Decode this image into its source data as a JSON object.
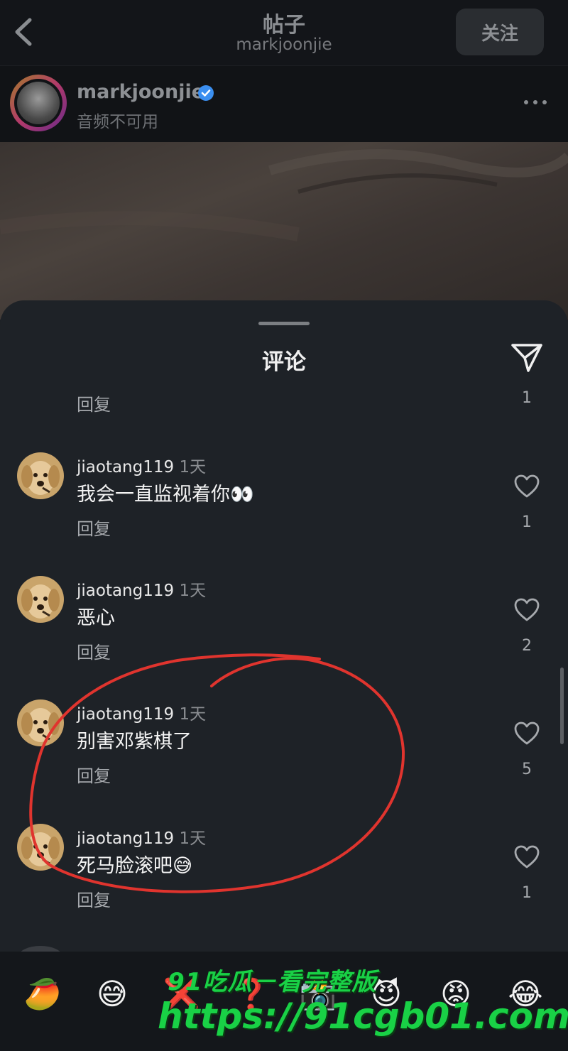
{
  "header": {
    "title": "帖子",
    "subtitle": "markjoonjie",
    "follow_label": "关注"
  },
  "author": {
    "name": "markjoonjie",
    "status": "音频不可用"
  },
  "sheet": {
    "title": "评论",
    "top_reply": "回复",
    "top_count": "1"
  },
  "comments": [
    {
      "user": "jiaotang119",
      "time": "1天",
      "text": "我会一直监视着你👀",
      "reply": "回复",
      "likes": "1"
    },
    {
      "user": "jiaotang119",
      "time": "1天",
      "text": "恶心",
      "reply": "回复",
      "likes": "2"
    },
    {
      "user": "jiaotang119",
      "time": "1天",
      "text": "别害邓紫棋了",
      "reply": "回复",
      "likes": "5"
    },
    {
      "user": "jiaotang119",
      "time": "1天",
      "text": "死马脸滚吧😅",
      "reply": "回复",
      "likes": "1"
    }
  ],
  "emoji_bar": [
    "🥭",
    "😅",
    "❌",
    "❓",
    "📸",
    "😈",
    "😡",
    "😂"
  ],
  "watermark": {
    "line1": "91吃瓜－看完整版",
    "line2": "https://91cgb01.com"
  },
  "colors": {
    "annotation_circle": "#e0342e",
    "watermark": "#19d146",
    "verified": "#3b8ff0"
  }
}
